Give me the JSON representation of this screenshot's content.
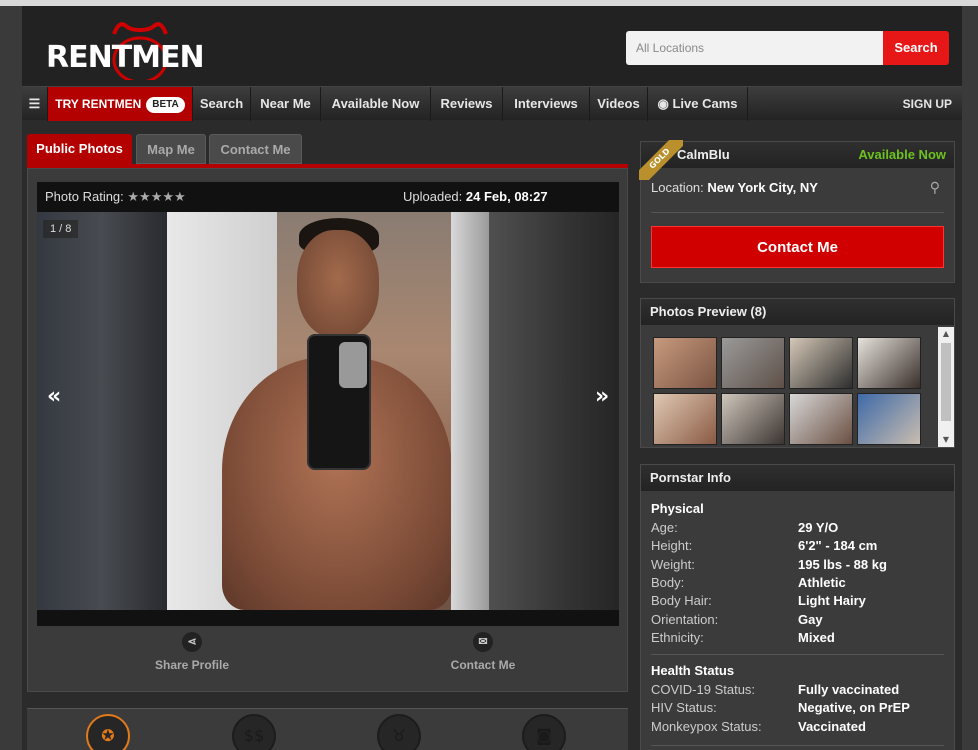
{
  "brand": {
    "logo_text": "RENTMEN"
  },
  "search": {
    "placeholder": "All Locations",
    "button_label": "Search"
  },
  "nav": {
    "menu_icon": "hamburger-icon",
    "try_label": "TRY RENTMEN",
    "beta_label": "BETA",
    "items": [
      "Search",
      "Near Me",
      "Available Now",
      "Reviews",
      "Interviews",
      "Videos",
      "Live Cams"
    ],
    "signup_label": "SIGN UP"
  },
  "tabs": [
    "Public Photos",
    "Map Me",
    "Contact Me"
  ],
  "photo": {
    "rating_label": "Photo Rating:",
    "rating_stars": "★★★★★",
    "uploaded_label": "Uploaded:",
    "uploaded_value": "24 Feb, 08:27",
    "counter": "1 / 8",
    "prev_icon": "«",
    "next_icon": "»"
  },
  "actions": {
    "share_label": "Share Profile",
    "contact_label": "Contact Me"
  },
  "profile": {
    "badge": "GOLD",
    "username": "CalmBlu",
    "availability": "Available Now",
    "location_label": "Location:",
    "location_value": "New York City, NY",
    "contact_button": "Contact Me"
  },
  "photos_preview": {
    "title": "Photos Preview (8)",
    "count": 8
  },
  "info": {
    "title": "Pornstar Info",
    "physical_title": "Physical",
    "physical": [
      {
        "k": "Age:",
        "v": "29 Y/O"
      },
      {
        "k": "Height:",
        "v": "6'2\" - 184 cm"
      },
      {
        "k": "Weight:",
        "v": "195 lbs - 88 kg"
      },
      {
        "k": "Body:",
        "v": "Athletic"
      },
      {
        "k": "Body Hair:",
        "v": "Light Hairy"
      },
      {
        "k": "Orientation:",
        "v": "Gay"
      },
      {
        "k": "Ethnicity:",
        "v": "Mixed"
      }
    ],
    "health_title": "Health Status",
    "health": [
      {
        "k": "COVID-19 Status:",
        "v": "Fully vaccinated"
      },
      {
        "k": "HIV Status:",
        "v": "Negative, on PrEP"
      },
      {
        "k": "Monkeypox Status:",
        "v": "Vaccinated"
      }
    ]
  },
  "colors": {
    "accent_red": "#d10000",
    "available_green": "#6dc21f",
    "gold": "#b9902b"
  }
}
